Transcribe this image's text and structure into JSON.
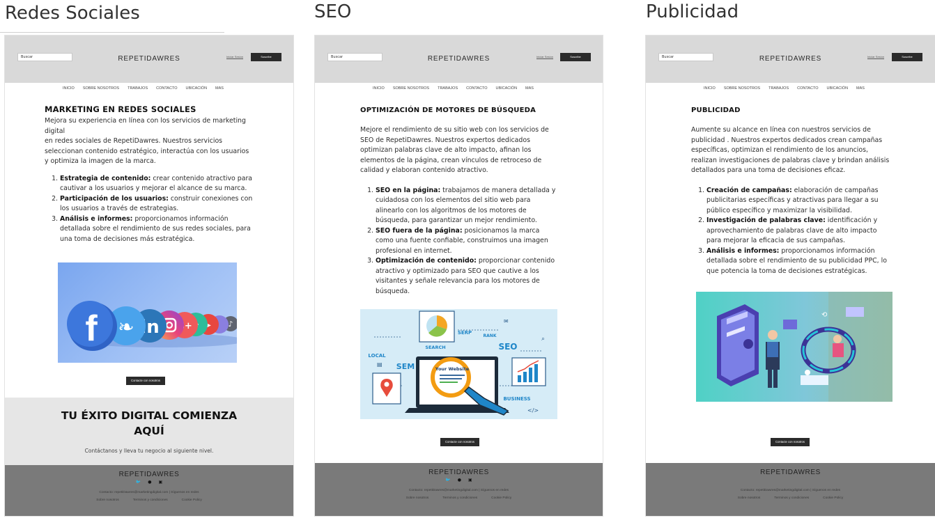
{
  "columns": [
    {
      "title": "Redes Sociales",
      "header": {
        "search_placeholder": "Buscar",
        "brand": "REPETIDAWRES",
        "login": "Iniciar Sesion",
        "subscribe": "Suscribe"
      },
      "nav": [
        "INICIO",
        "SOBRE NOSOTROS",
        "TRABAJOS",
        "CONTACTO",
        "UBICACIÓN",
        "MAS"
      ],
      "article": {
        "heading": "MARKETING EN REDES SOCIALES",
        "intro_1": "Mejora su experiencia en línea con los servicios de marketing digital",
        "intro_2": "en redes sociales de RepetiDawres. Nuestros servicios seleccionan contenido estratégico, interactúa con los usuarios y optimiza la imagen de la marca.",
        "items": [
          {
            "strong": "Estrategia de contenido:",
            "text": " crear contenido atractivo para cautivar a los usuarios y mejorar el alcance de su marca."
          },
          {
            "strong": "Participación de los usuarios:",
            "text": " construir conexiones con los usuarios a través de estrategias."
          },
          {
            "strong": "Análisis e informes:",
            "text": " proporcionamos información detallada sobre el rendimiento de sus redes sociales, para una toma de decisiones más estratégica."
          }
        ]
      },
      "image_label": "social-media-icons-image",
      "cta": "Contacte con nosotros",
      "band": {
        "title": "TU ÉXITO DIGITAL COMIENZA AQUÍ",
        "subtitle": "Contáctanos y lleva tu negocio al siguiente nivel."
      },
      "footer": {
        "brand": "REPETIDAWRES",
        "contact": "Contacto: repetiDawres@marketingdigital.com | Síguenos en redes",
        "links": [
          "Sobre nosotros",
          "Terminos y condiciones",
          "Cookie Policy"
        ]
      }
    },
    {
      "title": "SEO",
      "header": {
        "search_placeholder": "Buscar",
        "brand": "REPETIDAWRES",
        "login": "Iniciar Sesion",
        "subscribe": "Suscribe"
      },
      "nav": [
        "INICIO",
        "SOBRE NOSOTROS",
        "TRABAJOS",
        "CONTACTO",
        "UBICACIÓN",
        "MAS"
      ],
      "article": {
        "heading": "OPTIMIZACIÓN DE MOTORES DE BÚSQUEDA",
        "intro_1": "Mejore el rendimiento de su sitio web con los servicios de SEO de RepetiDawres. Nuestros expertos dedicados optimizan palabras clave de alto impacto, afinan los elementos de la página, crean vínculos de retroceso de calidad y elaboran contenido atractivo.",
        "items": [
          {
            "strong": "SEO en la página:",
            "text": " trabajamos de manera detallada y cuidadosa con los elementos del sitio web para alinearlo con los algoritmos de los motores de búsqueda, para garantizar un mejor rendimiento."
          },
          {
            "strong": "SEO fuera de la página:",
            "text": "  posicionamos la marca como una fuente confiable, construimos una imagen profesional en internet."
          },
          {
            "strong": "Optimización de contenido:",
            "text": " proporcionar contenido atractivo y optimizado para SEO que cautive a los visitantes y señale relevancia para los motores de búsqueda."
          }
        ]
      },
      "image_words": {
        "search": "SEARCH",
        "serp": "SERP",
        "rank": "RANK",
        "seo": "SEO",
        "local": "LOCAL",
        "sem": "SEM",
        "business": "BUSINESS",
        "your_website": "Your Website"
      },
      "cta": "Contacte con nosotros",
      "footer": {
        "brand": "REPETIDAWRES",
        "contact": "Contacto: repetiDawres@marketingdigital.com | Síguenos en redes",
        "links": [
          "Sobre nosotros",
          "Terminos y condiciones",
          "Cookie Policy"
        ]
      }
    },
    {
      "title": "Publicidad",
      "header": {
        "search_placeholder": "Buscar",
        "brand": "REPETIDAWRES",
        "login": "Iniciar Sesion",
        "subscribe": "Suscribe"
      },
      "nav": [
        "INICIO",
        "SOBRE NOSOTROS",
        "TRABAJOS",
        "CONTACTO",
        "UBICACIÓN",
        "MAS"
      ],
      "article": {
        "heading": "PUBLICIDAD",
        "intro_1": "Aumente su alcance en línea con nuestros servicios de publicidad . Nuestros expertos dedicados crean campañas específicas, optimizan el rendimiento de los anuncios, realizan investigaciones de palabras clave y brindan análisis detallados para una toma de decisiones eficaz.",
        "items": [
          {
            "strong": "Creación de campañas:",
            "text": " elaboración de campañas publicitarias específicas y atractivas para llegar a su público específico y maximizar la visibilidad."
          },
          {
            "strong": "Investigación de palabras clave:",
            "text": " identificación y aprovechamiento de palabras clave de alto impacto para mejorar la eficacia de sus campañas."
          },
          {
            "strong": "Análisis e informes:",
            "text": " proporcionamos información detallada sobre el rendimiento de su publicidad PPC, lo que potencia la toma de decisiones estratégicas."
          }
        ]
      },
      "cta": "Contacte con nosotros",
      "footer": {
        "brand": "REPETIDAWRES",
        "contact": "Contacto: repetiDawres@marketingdigital.com | Síguenos en redes",
        "links": [
          "Sobre nosotros",
          "Terminos y condiciones",
          "Cookie Policy"
        ]
      }
    }
  ],
  "colors": {
    "header_bg": "#d9d9d9",
    "band_bg": "#e6e6e6",
    "footer_bg": "#7a7a7a",
    "button_bg": "#2b2b2b"
  }
}
